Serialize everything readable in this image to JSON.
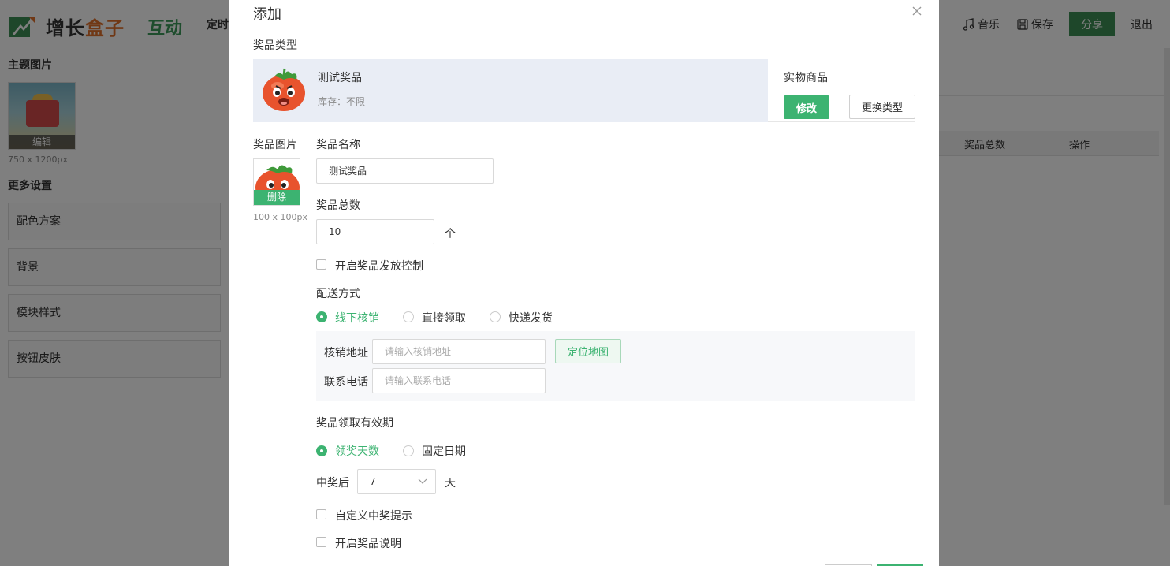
{
  "app": {
    "logo_main": "增长",
    "logo_accent": "盒子",
    "logo_sub": "互动",
    "nav_first": "定时",
    "music_label": "音乐",
    "save_label": "保存",
    "share_label": "分享",
    "exit_label": "退出",
    "brand_color": "#3c8f55"
  },
  "left_panel": {
    "theme_heading": "主题图片",
    "theme_edit_label": "编辑",
    "theme_dim": "750 x 1200px",
    "more_heading": "更多设置",
    "items": [
      "配色方案",
      "背景",
      "模块样式",
      "按钮皮肤"
    ]
  },
  "right_panel": {
    "col_total": "奖品总数",
    "col_action": "操作"
  },
  "modal": {
    "title": "添加",
    "prize_type_label": "奖品类型",
    "prize_card": {
      "name": "测试奖品",
      "stock": "库存：不限",
      "type": "实物商品",
      "modify_label": "修改",
      "change_type_label": "更换类型"
    },
    "prize_image_label": "奖品图片",
    "delete_label": "删除",
    "image_dim": "100 x 100px",
    "prize_name_label": "奖品名称",
    "prize_name_value": "测试奖品",
    "prize_total_label": "奖品总数",
    "prize_total_value": "10",
    "prize_total_unit": "个",
    "release_control_label": "开启奖品发放控制",
    "delivery_label": "配送方式",
    "delivery_options": [
      {
        "label": "线下核销",
        "selected": true
      },
      {
        "label": "直接领取",
        "selected": false
      },
      {
        "label": "快递发货",
        "selected": false
      }
    ],
    "address_label": "核销地址",
    "address_placeholder": "请输入核销地址",
    "locate_map_label": "定位地图",
    "phone_label": "联系电话",
    "phone_placeholder": "请输入联系电话",
    "validity_label": "奖品领取有效期",
    "validity_options": [
      {
        "label": "领奖天数",
        "selected": true
      },
      {
        "label": "固定日期",
        "selected": false
      }
    ],
    "after_win_label": "中奖后",
    "days_value": "7",
    "days_unit": "天",
    "custom_prompt_label": "自定义中奖提示",
    "prize_desc_label": "开启奖品说明",
    "accent_color": "#3cb371"
  }
}
